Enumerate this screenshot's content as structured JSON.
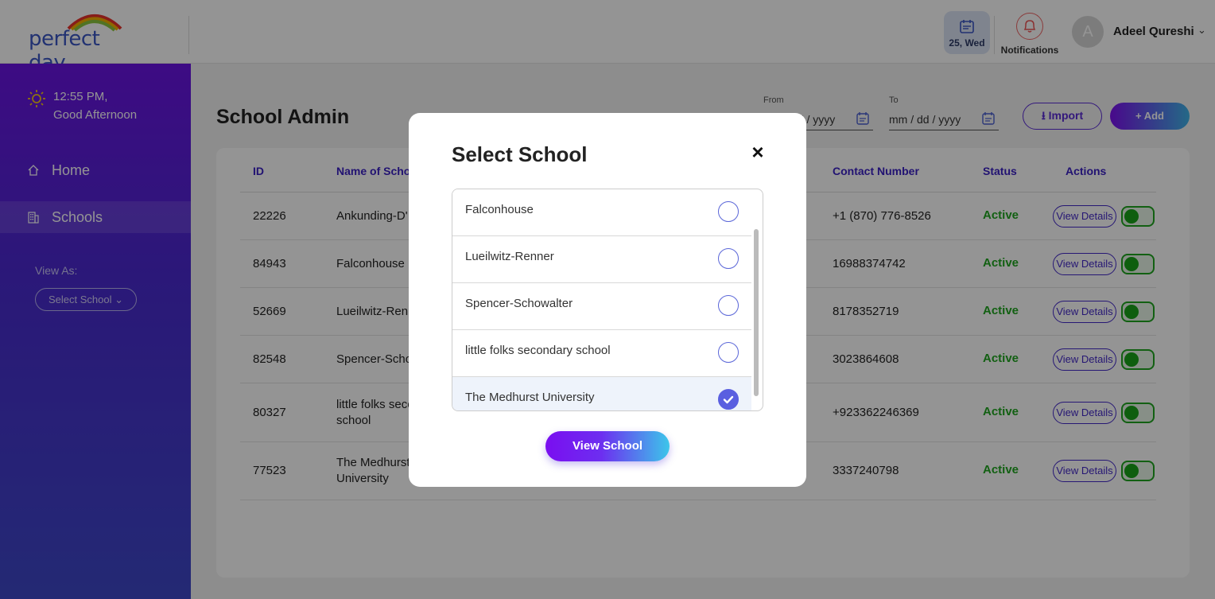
{
  "header": {
    "logo_text": "perfect day",
    "date_label": "25, Wed",
    "notifications_label": "Notifications",
    "avatar_initial": "A",
    "user_name": "Adeel Qureshi"
  },
  "sidebar": {
    "time": "12:55 PM,",
    "greeting": "Good Afternoon",
    "items": [
      {
        "label": "Home",
        "icon": "home-icon"
      },
      {
        "label": "Schools",
        "icon": "building-icon"
      }
    ],
    "view_as_label": "View As:",
    "select_school_label": "Select School"
  },
  "main": {
    "title": "School Admin",
    "from_label": "From",
    "from_placeholder": "mm / dd / yyyy",
    "to_label": "To",
    "to_placeholder": "mm / dd / yyyy",
    "import_label": "Import",
    "add_label": "+ Add"
  },
  "table": {
    "headers": [
      "ID",
      "Name of School",
      "Contact Number",
      "Status",
      "Actions"
    ],
    "rows": [
      {
        "id": "22226",
        "name": "Ankunding-D'...",
        "contact": "+1 (870) 776-8526",
        "status": "Active",
        "action": "View Details"
      },
      {
        "id": "84943",
        "name": "Falconhouse",
        "contact": "16988374742",
        "status": "Active",
        "action": "View Details"
      },
      {
        "id": "52669",
        "name": "Lueilwitz-Renn...",
        "contact": "8178352719",
        "status": "Active",
        "action": "View Details"
      },
      {
        "id": "82548",
        "name": "Spencer-Schow...",
        "contact": "3023864608",
        "status": "Active",
        "action": "View Details"
      },
      {
        "id": "80327",
        "name": "little folks seco...",
        "name2": "school",
        "contact": "+923362246369",
        "status": "Active",
        "action": "View Details"
      },
      {
        "id": "77523",
        "name": "The Medhurst",
        "name2": "University",
        "contact": "3337240798",
        "status": "Active",
        "action": "View Details"
      }
    ]
  },
  "modal": {
    "title": "Select School",
    "close_label": "×",
    "options": [
      {
        "name": "Falconhouse",
        "selected": false
      },
      {
        "name": "Lueilwitz-Renner",
        "selected": false
      },
      {
        "name": "Spencer-Schowalter",
        "selected": false
      },
      {
        "name": "little folks secondary school",
        "selected": false
      },
      {
        "name": "The Medhurst University",
        "selected": true
      }
    ],
    "button_label": "View School"
  },
  "colors": {
    "accent": "#5b2bd6",
    "status_active": "#1fa51f",
    "sidebar_top": "#6a14e3",
    "sidebar_bottom": "#3e48c9"
  }
}
